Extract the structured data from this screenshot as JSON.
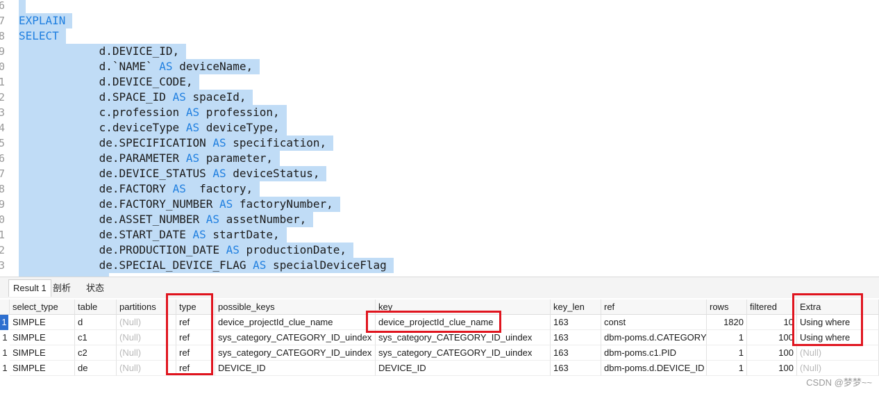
{
  "editor": {
    "lines": [
      {
        "ln": "6",
        "text": []
      },
      {
        "ln": "7",
        "text": [
          {
            "t": "EXPLAIN",
            "kw": true
          }
        ]
      },
      {
        "ln": "8",
        "text": [
          {
            "t": "SELECT",
            "kw": true
          }
        ]
      },
      {
        "ln": "9",
        "text": [
          {
            "t": "            d.DEVICE_ID,"
          }
        ]
      },
      {
        "ln": "0",
        "text": [
          {
            "t": "            d.`NAME` "
          },
          {
            "t": "AS",
            "kw": true
          },
          {
            "t": " deviceName,"
          }
        ]
      },
      {
        "ln": "1",
        "text": [
          {
            "t": "            d.DEVICE_CODE,"
          }
        ]
      },
      {
        "ln": "2",
        "text": [
          {
            "t": "            d.SPACE_ID "
          },
          {
            "t": "AS",
            "kw": true
          },
          {
            "t": " spaceId,"
          }
        ]
      },
      {
        "ln": "3",
        "text": [
          {
            "t": "            c.profession "
          },
          {
            "t": "AS",
            "kw": true
          },
          {
            "t": " profession,"
          }
        ]
      },
      {
        "ln": "4",
        "text": [
          {
            "t": "            c.deviceType "
          },
          {
            "t": "AS",
            "kw": true
          },
          {
            "t": " deviceType,"
          }
        ]
      },
      {
        "ln": "5",
        "text": [
          {
            "t": "            de.SPECIFICATION "
          },
          {
            "t": "AS",
            "kw": true
          },
          {
            "t": " specification,"
          }
        ]
      },
      {
        "ln": "6",
        "text": [
          {
            "t": "            de.PARAMETER "
          },
          {
            "t": "AS",
            "kw": true
          },
          {
            "t": " parameter,"
          }
        ]
      },
      {
        "ln": "7",
        "text": [
          {
            "t": "            de.DEVICE_STATUS "
          },
          {
            "t": "AS",
            "kw": true
          },
          {
            "t": " deviceStatus,"
          }
        ]
      },
      {
        "ln": "8",
        "text": [
          {
            "t": "            de.FACTORY "
          },
          {
            "t": "AS",
            "kw": true
          },
          {
            "t": "  factory,"
          }
        ]
      },
      {
        "ln": "9",
        "text": [
          {
            "t": "            de.FACTORY_NUMBER "
          },
          {
            "t": "AS",
            "kw": true
          },
          {
            "t": " factoryNumber,"
          }
        ]
      },
      {
        "ln": "0",
        "text": [
          {
            "t": "            de.ASSET_NUMBER "
          },
          {
            "t": "AS",
            "kw": true
          },
          {
            "t": " assetNumber,"
          }
        ]
      },
      {
        "ln": "1",
        "text": [
          {
            "t": "            de.START_DATE "
          },
          {
            "t": "AS",
            "kw": true
          },
          {
            "t": " startDate,"
          }
        ]
      },
      {
        "ln": "2",
        "text": [
          {
            "t": "            de.PRODUCTION_DATE "
          },
          {
            "t": "AS",
            "kw": true
          },
          {
            "t": " productionDate,"
          }
        ]
      },
      {
        "ln": "3",
        "text": [
          {
            "t": "            de.SPECIAL_DEVICE_FLAG "
          },
          {
            "t": "AS",
            "kw": true
          },
          {
            "t": " specialDeviceFlag"
          }
        ]
      }
    ]
  },
  "tabs": [
    {
      "label": "Result 1",
      "active": true
    },
    {
      "label": "剖析",
      "active": false
    },
    {
      "label": "状态",
      "active": false
    }
  ],
  "grid": {
    "columns": [
      "select_type",
      "table",
      "partitions",
      "type",
      "possible_keys",
      "key",
      "key_len",
      "ref",
      "rows",
      "filtered",
      "Extra"
    ],
    "rows": [
      {
        "row": "1",
        "cells": [
          "SIMPLE",
          "d",
          "(Null)",
          "ref",
          "device_projectId_clue_name",
          "device_projectId_clue_name",
          "163",
          "const",
          "1820",
          "10",
          "Using where"
        ]
      },
      {
        "row": "1",
        "cells": [
          "SIMPLE",
          "c1",
          "(Null)",
          "ref",
          "sys_category_CATEGORY_ID_uindex",
          "sys_category_CATEGORY_ID_uindex",
          "163",
          "dbm-poms.d.CATEGORY_",
          "1",
          "100",
          "Using where"
        ]
      },
      {
        "row": "1",
        "cells": [
          "SIMPLE",
          "c2",
          "(Null)",
          "ref",
          "sys_category_CATEGORY_ID_uindex",
          "sys_category_CATEGORY_ID_uindex",
          "163",
          "dbm-poms.c1.PID",
          "1",
          "100",
          "(Null)"
        ]
      },
      {
        "row": "1",
        "cells": [
          "SIMPLE",
          "de",
          "(Null)",
          "ref",
          "DEVICE_ID",
          "DEVICE_ID",
          "163",
          "dbm-poms.d.DEVICE_ID",
          "1",
          "100",
          "(Null)"
        ]
      }
    ]
  },
  "watermark": "CSDN @梦梦~~",
  "colors": {
    "selection": "#c0dcf6",
    "keyword": "#1f7fe0",
    "highlight_box": "#e0141e"
  }
}
